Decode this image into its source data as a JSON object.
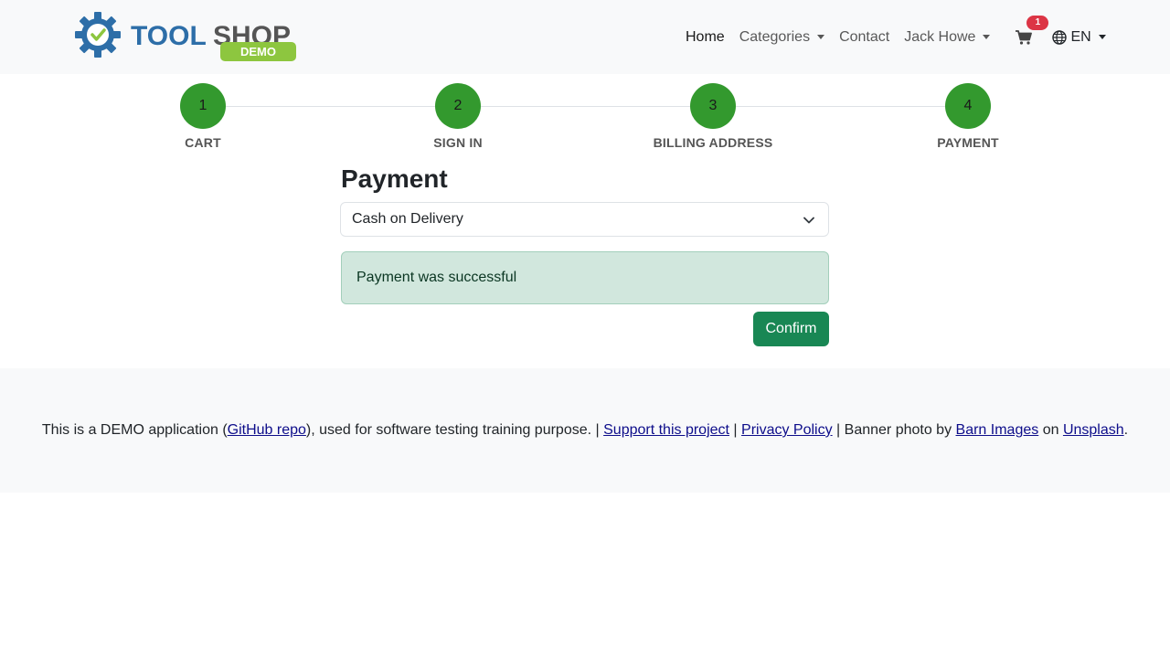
{
  "brand": {
    "name_part1": "TOOL",
    "name_part2": "SHOP",
    "badge": "DEMO"
  },
  "nav": {
    "home": "Home",
    "categories": "Categories",
    "contact": "Contact",
    "user": "Jack Howe",
    "cart_count": "1",
    "language": "EN"
  },
  "steps": [
    {
      "number": "1",
      "label": "CART"
    },
    {
      "number": "2",
      "label": "SIGN IN"
    },
    {
      "number": "3",
      "label": "BILLING ADDRESS"
    },
    {
      "number": "4",
      "label": "PAYMENT"
    }
  ],
  "payment": {
    "title": "Payment",
    "method": "Cash on Delivery",
    "alert": "Payment was successful",
    "confirm_label": "Confirm"
  },
  "footer": {
    "text1": "This is a DEMO application (",
    "link_github": "GitHub repo",
    "text2": "), used for software testing training purpose. | ",
    "link_support": "Support this project",
    "sep1": " | ",
    "link_privacy": "Privacy Policy",
    "text3": " | Banner photo by ",
    "link_barn": "Barn Images",
    "text4": " on ",
    "link_unsplash": "Unsplash",
    "text5": "."
  },
  "colors": {
    "step_fill": "#33992e",
    "confirm_button": "#198754",
    "alert_bg": "#d1e7dd",
    "cart_badge": "#dc3545",
    "logo_blue": "#2d6ea8",
    "logo_green": "#8dc63f"
  }
}
